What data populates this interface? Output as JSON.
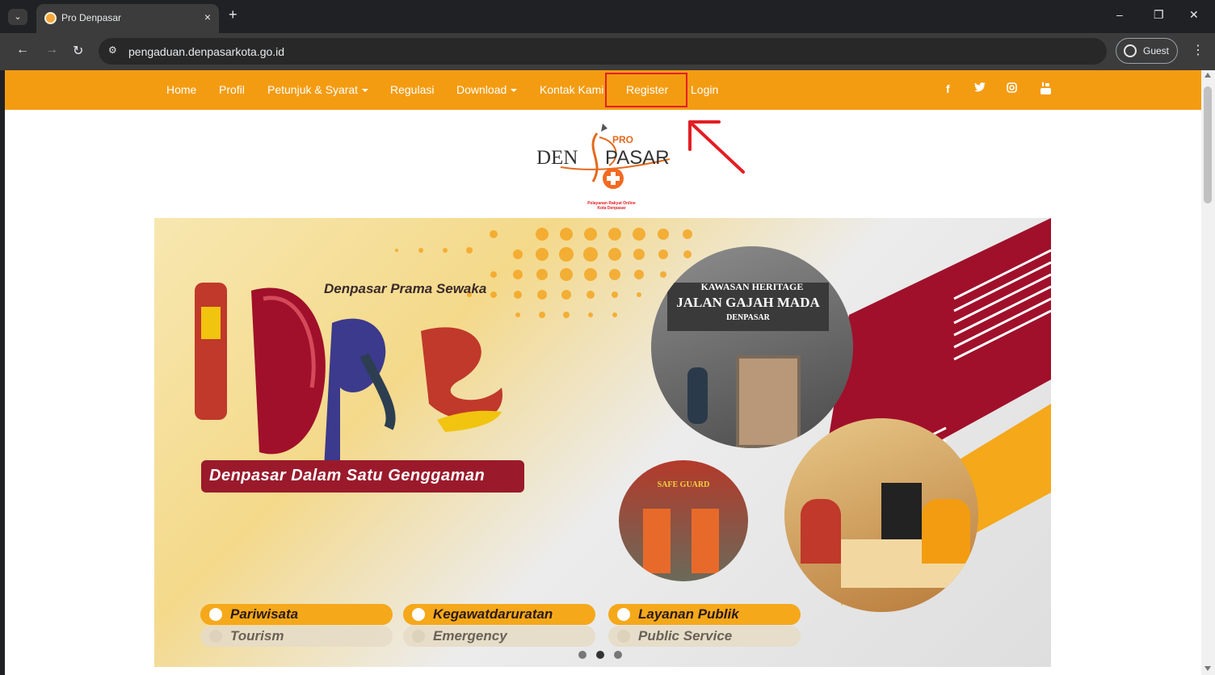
{
  "browser": {
    "tab_title": "Pro Denpasar",
    "tab_close": "×",
    "new_tab": "+",
    "url": "pengaduan.denpasarkota.go.id",
    "profile_label": "Guest",
    "controls": {
      "minimize": "–",
      "restore": "❐",
      "close": "✕"
    },
    "nav": {
      "back": "←",
      "forward": "→",
      "reload": "↻",
      "site_info": "⚙",
      "menu": "⋮",
      "tab_search": "⌄"
    }
  },
  "navbar": {
    "items": [
      {
        "label": "Home"
      },
      {
        "label": "Profil"
      },
      {
        "label": "Petunjuk & Syarat",
        "dropdown": true
      },
      {
        "label": "Regulasi"
      },
      {
        "label": "Download",
        "dropdown": true
      },
      {
        "label": "Kontak Kami"
      },
      {
        "label": "Register",
        "highlighted": true
      },
      {
        "label": "Login"
      }
    ],
    "social_icons": [
      "facebook-icon",
      "twitter-icon",
      "instagram-icon",
      "youtube-icon"
    ],
    "social_glyphs": {
      "facebook": "f",
      "twitter": "🐦",
      "instagram": "◎",
      "youtube": "▶"
    },
    "color": "#f39c12",
    "highlight_color": "#e31e24"
  },
  "logo": {
    "pro": "PRO",
    "den": "DEN",
    "pasar": "PASAR",
    "tagline_1": "Pelayanan Rakyat Online",
    "tagline_2": "Kota Denpasar"
  },
  "banner": {
    "title": "Denpasar Prama Sewaka",
    "slogan": "Denpasar Dalam Satu Genggaman",
    "photo_sign_1": "KAWASAN HERITAGE",
    "photo_sign_2": "JALAN GAJAH MADA",
    "photo_sign_3": "DENPASAR",
    "photo_ambulance": "SAFE GUARD",
    "pills": [
      {
        "main": "Pariwisata",
        "sub": "Tourism"
      },
      {
        "main": "Kegawatdaruratan",
        "sub": "Emergency"
      },
      {
        "main": "Layanan Publik",
        "sub": "Public Service"
      }
    ],
    "carousel_active_index": 1,
    "carousel_count": 3
  }
}
